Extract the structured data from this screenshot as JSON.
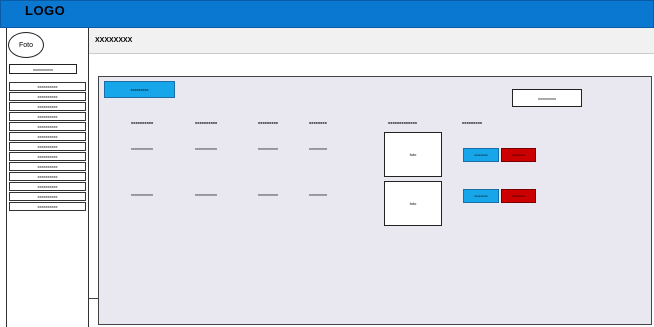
{
  "app": {
    "logo": "LOGO"
  },
  "sidebar": {
    "avatar_label": "Foto",
    "user_label": "xxxxxxxxxx",
    "items": [
      {
        "label": "xxxxxxxxxx"
      },
      {
        "label": "xxxxxxxxxx"
      },
      {
        "label": "xxxxxxxxxx"
      },
      {
        "label": "xxxxxxxxxx"
      },
      {
        "label": "xxxxxxxxxx"
      },
      {
        "label": "xxxxxxxxxx"
      },
      {
        "label": "xxxxxxxxxx"
      },
      {
        "label": "xxxxxxxxxx"
      },
      {
        "label": "xxxxxxxxxx"
      },
      {
        "label": "xxxxxxxxxx"
      },
      {
        "label": "xxxxxxxxxx"
      },
      {
        "label": "xxxxxxxxxx"
      },
      {
        "label": "xxxxxxxxxx"
      }
    ]
  },
  "header": {
    "title": "XXXXXXXX"
  },
  "toolbar": {
    "add_label": "xxxxxxxxx",
    "search_value": "xxxxxxxxx"
  },
  "table": {
    "headers": [
      "xxxxxxxxxx",
      "xxxxxxxxxx",
      "xxxxxxxxx",
      "xxxxxxxx",
      "xxxxxxxxxxxxx",
      "xxxxxxxxx"
    ],
    "rows": [
      {
        "cells": [
          "xxxxxxxxxxx",
          "xxxxxxxxxxx",
          "xxxxxxxxxx",
          "xxxxxxxxx"
        ],
        "photo": "foto",
        "edit": "xxxxxxxxx",
        "delete": "xxxxxxxxx"
      },
      {
        "cells": [
          "xxxxxxxxxxx",
          "xxxxxxxxxxx",
          "xxxxxxxxxx",
          "xxxxxxxxx"
        ],
        "photo": "foto",
        "edit": "xxxxxxxxx",
        "delete": "xxxxxxxxx"
      }
    ]
  },
  "colors": {
    "topbar": "#0a78d1",
    "button_blue": "#16a6e9",
    "button_red": "#cc0000",
    "panel_bg": "#e9e7f0"
  }
}
